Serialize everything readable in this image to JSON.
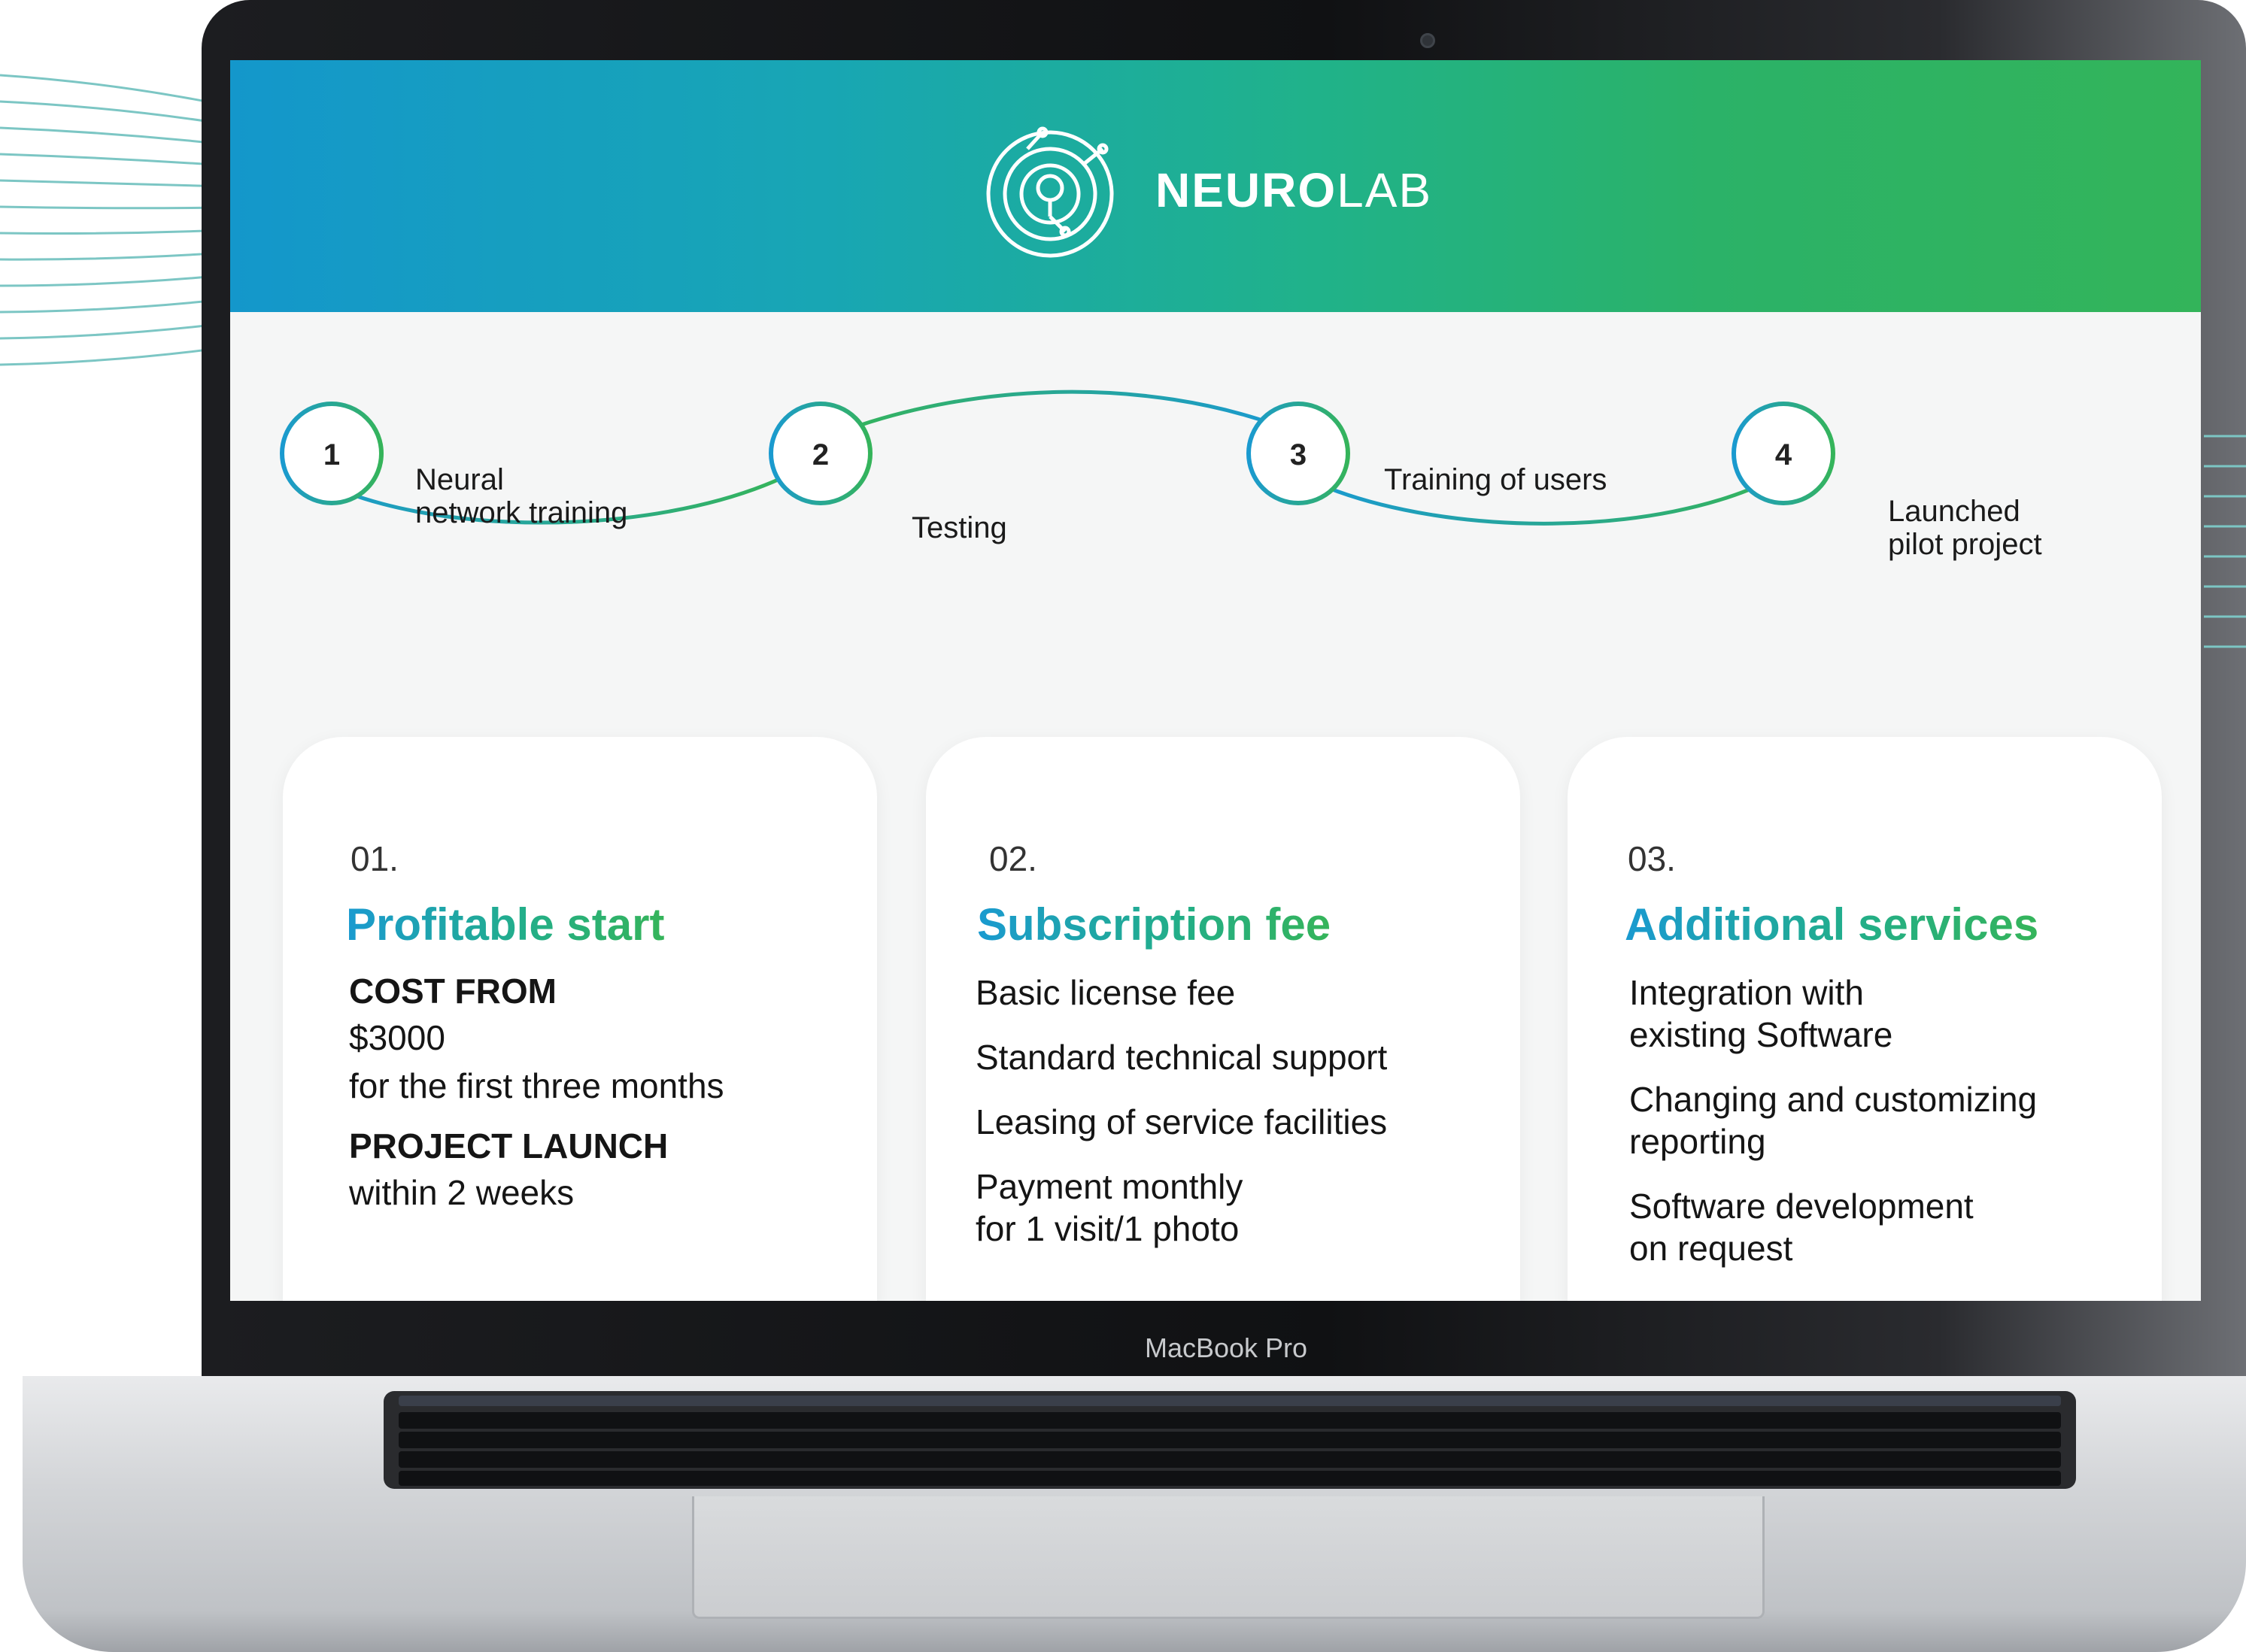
{
  "brand": {
    "bold": "NEURO",
    "light": "LAB"
  },
  "timeline": {
    "steps": [
      {
        "number": "1",
        "label_lines": [
          "Neural",
          "network training"
        ]
      },
      {
        "number": "2",
        "label_lines": [
          "Testing"
        ]
      },
      {
        "number": "3",
        "label_lines": [
          "Training of users"
        ]
      },
      {
        "number": "4",
        "label_lines": [
          "Launched",
          "pilot project"
        ]
      }
    ]
  },
  "cards": [
    {
      "number": "01.",
      "title": "Profitable start",
      "lines": [
        {
          "text": "COST FROM",
          "bold": true
        },
        {
          "text": "$3000",
          "bold": false
        },
        {
          "text": "for the first three months",
          "bold": false
        },
        {
          "text": "PROJECT LAUNCH",
          "bold": true
        },
        {
          "text": "within 2 weeks",
          "bold": false
        }
      ]
    },
    {
      "number": "02.",
      "title": "Subscription fee",
      "lines": [
        {
          "text": "Basic license fee",
          "bold": false
        },
        {
          "text": "Standard technical support",
          "bold": false
        },
        {
          "text": "Leasing of service facilities",
          "bold": false
        },
        {
          "text": "Payment monthly",
          "bold": false
        },
        {
          "text": "for 1 visit/1 photo",
          "bold": false
        }
      ]
    },
    {
      "number": "03.",
      "title": "Additional services",
      "lines": [
        {
          "text": "Integration with",
          "bold": false
        },
        {
          "text": "existing Software",
          "bold": false
        },
        {
          "text": "Changing and customizing",
          "bold": false
        },
        {
          "text": "reporting",
          "bold": false
        },
        {
          "text": "Software development",
          "bold": false
        },
        {
          "text": "on request",
          "bold": false
        }
      ]
    }
  ],
  "device_label": "MacBook Pro",
  "colors": {
    "gradient_blue": "#1497cb",
    "gradient_green": "#33b45a",
    "text_dark": "#151515"
  }
}
